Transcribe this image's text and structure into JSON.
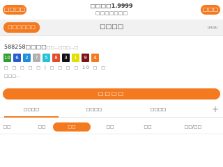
{
  "header": {
    "left_button": "□□□□",
    "balance": "□□□□1.9999",
    "subtitle": "□□□□□□□",
    "right_button": "□□□"
  },
  "titlebar": {
    "left_button": "□□□□□□",
    "title": "□□□□",
    "right_text": "urusu"
  },
  "issue": {
    "number": "588258□□□□",
    "suffix": "□□...□□□...□",
    "meta": "□ □ □ □ □ | □ □ □ □ 10 □ □",
    "more": "□□□..."
  },
  "balls": [
    {
      "value": "10",
      "color": "#2f9e2f"
    },
    {
      "value": "6",
      "color": "#2a5bd7"
    },
    {
      "value": "2",
      "color": "#1e8fd6"
    },
    {
      "value": "7",
      "color": "#b0b0b0"
    },
    {
      "value": "5",
      "color": "#27c2d8"
    },
    {
      "value": "8",
      "color": "#e24b2c"
    },
    {
      "value": "3",
      "color": "#111111"
    },
    {
      "value": "1",
      "color": "#e3e000"
    },
    {
      "value": "9",
      "color": "#7a1414"
    },
    {
      "value": "4",
      "color": "#f47a20"
    }
  ],
  "bet_button": "□□□□",
  "tabs": [
    "□□□□",
    "□□□□",
    "□□□□"
  ],
  "plus_label": "+",
  "filters": [
    "□□",
    "□□",
    "□□",
    "□□",
    "□□",
    "□□/□□"
  ],
  "colors": {
    "accent": "#f47a20"
  }
}
